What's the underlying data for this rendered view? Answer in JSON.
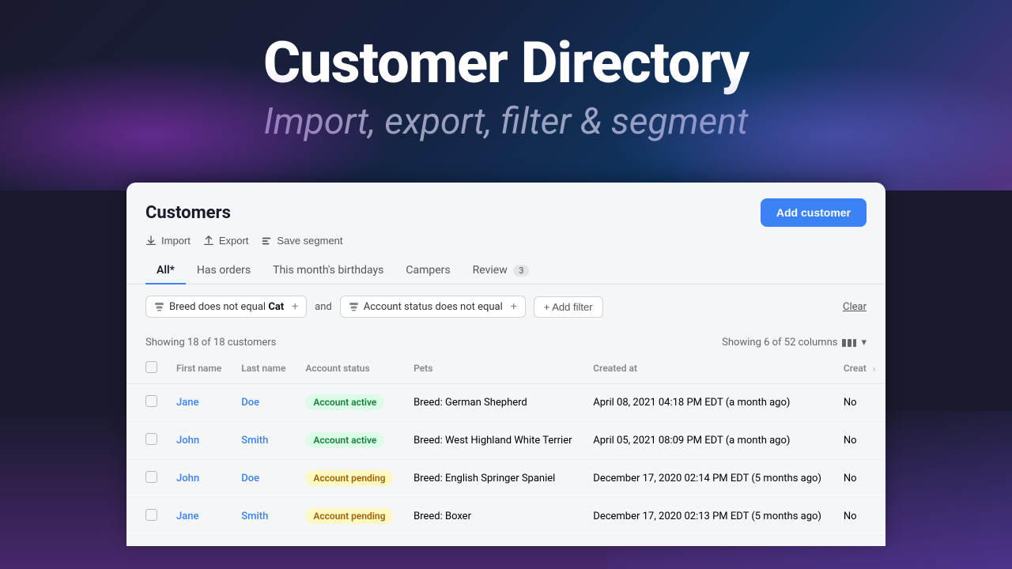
{
  "hero": {
    "title": "Customer Directory",
    "subtitle": "Import, export, filter & segment"
  },
  "panel": {
    "title": "Customers",
    "add_button": "Add customer",
    "toolbar": {
      "import_label": "Import",
      "export_label": "Export",
      "save_segment_label": "Save segment"
    },
    "tabs": [
      {
        "id": "all",
        "label": "All*",
        "active": true,
        "badge": null
      },
      {
        "id": "has-orders",
        "label": "Has orders",
        "active": false,
        "badge": null
      },
      {
        "id": "birthdays",
        "label": "This month's birthdays",
        "active": false,
        "badge": null
      },
      {
        "id": "campers",
        "label": "Campers",
        "active": false,
        "badge": null
      },
      {
        "id": "review",
        "label": "Review",
        "active": false,
        "badge": "3"
      }
    ],
    "filters": {
      "filter1": {
        "icon": "filter-icon",
        "label": "Breed",
        "operator": "does not equal",
        "value": "Cat"
      },
      "connector": "and",
      "filter2": {
        "icon": "filter-icon",
        "label": "Account status",
        "operator": "does not equal",
        "value": ""
      },
      "add_filter": "+ Add filter",
      "clear": "Clear"
    },
    "results": {
      "showing": "Showing 18 of 18 customers",
      "columns": "Showing 6 of 52 columns"
    },
    "table": {
      "columns": [
        "First name",
        "Last name",
        "Account status",
        "Pets",
        "Created at",
        "Creat"
      ],
      "rows": [
        {
          "first_name": "Jane",
          "last_name": "Doe",
          "account_status": "Account active",
          "account_status_type": "active",
          "pets": "Breed: German Shepherd",
          "created_at": "April 08, 2021 04:18 PM EDT (a month ago)",
          "extra": "No"
        },
        {
          "first_name": "John",
          "last_name": "Smith",
          "account_status": "Account active",
          "account_status_type": "active",
          "pets": "Breed: West Highland White Terrier",
          "created_at": "April 05, 2021 08:09 PM EDT (a month ago)",
          "extra": "No"
        },
        {
          "first_name": "John",
          "last_name": "Doe",
          "account_status": "Account pending",
          "account_status_type": "pending",
          "pets": "Breed: English Springer Spaniel",
          "created_at": "December 17, 2020 02:14 PM EDT (5 months ago)",
          "extra": "No"
        },
        {
          "first_name": "Jane",
          "last_name": "Smith",
          "account_status": "Account pending",
          "account_status_type": "pending",
          "pets": "Breed: Boxer",
          "created_at": "December 17, 2020 02:13 PM EDT (5 months ago)",
          "extra": "No"
        }
      ]
    }
  }
}
